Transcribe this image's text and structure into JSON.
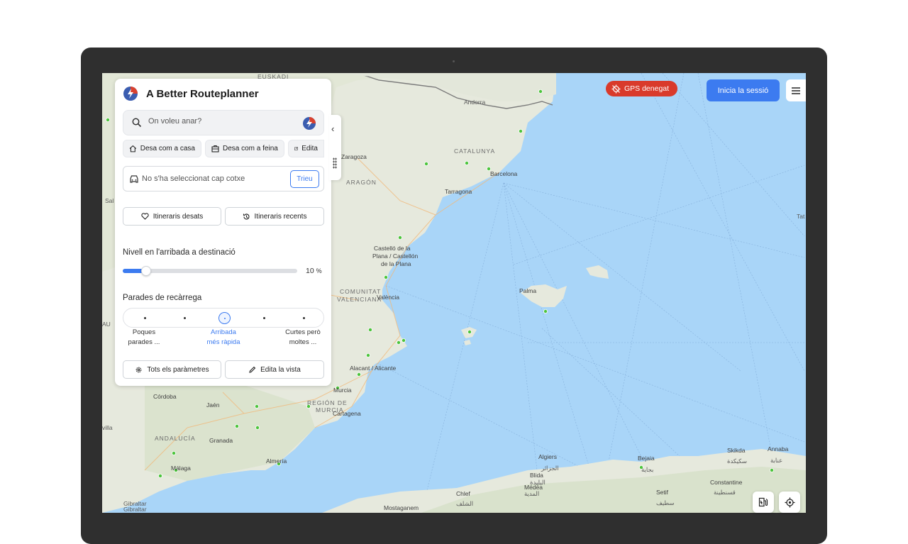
{
  "app": {
    "title": "A Better Routeplanner",
    "accent_color": "#3c7bf0"
  },
  "search": {
    "placeholder": "On voleu anar?"
  },
  "quick_actions": [
    {
      "label": "Desa com a casa",
      "icon": "home-icon"
    },
    {
      "label": "Desa com a feina",
      "icon": "briefcase-icon"
    },
    {
      "label": "Edita",
      "icon": "edit-icon"
    }
  ],
  "car": {
    "text": "No s'ha seleccionat cap cotxe",
    "button": "Trieu"
  },
  "itineraries": {
    "saved": "Itineraris desats",
    "recent": "Itineraris recents"
  },
  "arrival": {
    "label": "Nivell en l'arribada a destinació",
    "value": "10",
    "unit": "%",
    "fraction": 0.1
  },
  "charging_stops": {
    "label": "Parades de recàrrega",
    "left_label_1": "Poques",
    "left_label_2": "parades ...",
    "middle_label_1": "Arribada",
    "middle_label_2": "més ràpida",
    "right_label_1": "Curtes però",
    "right_label_2": "moltes ...",
    "positions": 5,
    "selected_index": 2
  },
  "footer_buttons": {
    "settings": "Tots els paràmetres",
    "edit_view": "Edita la vista"
  },
  "top_right": {
    "gps_status": "GPS denegat",
    "gps_color": "#d93a2b",
    "login": "Inicia la sessió"
  },
  "map_labels": {
    "euskadi": "EUSKADI",
    "andorra": "Andorra",
    "catalunya": "CATALUNYA",
    "zaragoza": "Zaragoza",
    "barcelona": "Barcelona",
    "aragon": "ARAGÓN",
    "tarragona": "Tarragona",
    "castello_1": "Castelló de la",
    "castello_2": "Plana / Castellón",
    "castello_3": "de la Plana",
    "comunitat_1": "COMUNITAT",
    "comunitat_2": "VALENCIANA",
    "valencia": "València",
    "palma": "Palma",
    "alacant": "Alacant / Alicante",
    "murcia": "Murcia",
    "region_1": "REGIÓN DE",
    "region_2": "MURCIA",
    "cartagena": "Cartagena",
    "cordoba": "Córdoba",
    "jaen": "Jaén",
    "andalucia": "ANDALUCÍA",
    "granada": "Granada",
    "almeria": "Almería",
    "malaga": "Málaga",
    "gibraltar_1": "Gibraltar",
    "gibraltar_2": "Gibraltar",
    "algiers_1": "Algiers",
    "algiers_2": "الجزائر",
    "blida_1": "Blida",
    "blida_2": "البليدة",
    "bejaia_1": "Bejaia",
    "bejaia_2": "بجاية",
    "skikda_1": "Skikda",
    "skikda_2": "سكيكدة",
    "annaba_1": "Annaba",
    "annaba_2": "عنابة",
    "medea_1": "Médéa",
    "medea_2": "المدية",
    "chlef_1": "Chlef",
    "chlef_2": "الشلف",
    "setif_1": "Setif",
    "setif_2": "سطيف",
    "constantine_1": "Constantine",
    "constantine_2": "قسنطينة",
    "mostaganem": "Mostaganem",
    "sal": "Sal",
    "tat": "Tat",
    "au": "AU",
    "villa": "villa"
  }
}
